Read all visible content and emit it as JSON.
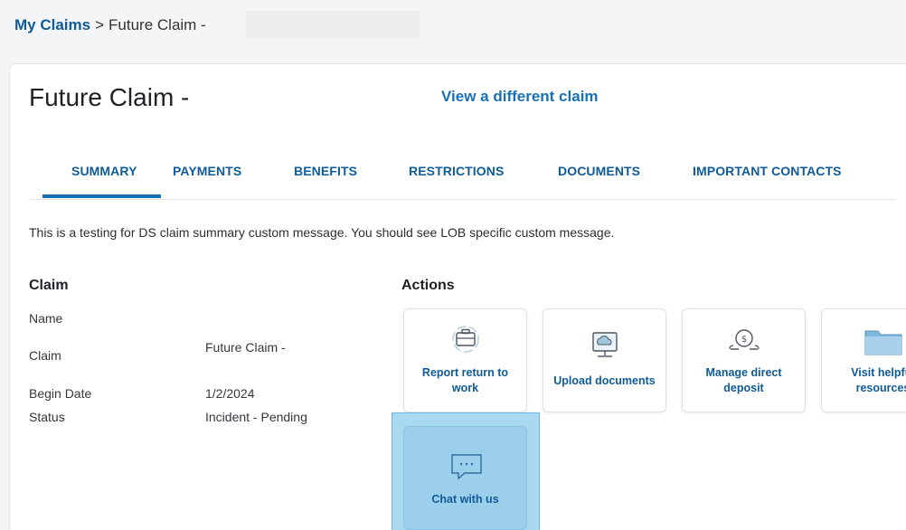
{
  "breadcrumb": {
    "root": "My Claims",
    "separator": ">",
    "current": "Future Claim -"
  },
  "header": {
    "title": "Future Claim -",
    "switch_link": "View a different claim"
  },
  "tabs": [
    {
      "label": "SUMMARY",
      "active": true
    },
    {
      "label": "PAYMENTS",
      "active": false
    },
    {
      "label": "BENEFITS",
      "active": false
    },
    {
      "label": "RESTRICTIONS",
      "active": false
    },
    {
      "label": "DOCUMENTS",
      "active": false
    },
    {
      "label": "IMPORTANT CONTACTS",
      "active": false
    }
  ],
  "message": "This is a testing for DS claim summary custom message. You should see LOB specific custom message.",
  "claim": {
    "heading": "Claim",
    "rows": [
      {
        "label": "Name",
        "value": ""
      },
      {
        "label": "Claim",
        "value": "Future Claim -"
      },
      {
        "label": "Begin Date",
        "value": "1/2/2024"
      },
      {
        "label": "Status",
        "value": "Incident - Pending"
      }
    ]
  },
  "actions": {
    "heading": "Actions",
    "items": [
      {
        "label": "Report return to work",
        "icon": "briefcase-icon"
      },
      {
        "label": "Upload documents",
        "icon": "cloud-upload-icon"
      },
      {
        "label": "Manage direct deposit",
        "icon": "money-deposit-icon"
      },
      {
        "label": "Visit helpful resources",
        "icon": "folder-icon"
      },
      {
        "label": "Chat with us",
        "icon": "chat-bubble-icon"
      }
    ]
  },
  "colors": {
    "link": "#0f5b97",
    "accent": "#1a70b5",
    "highlight": "#a9d8f1"
  }
}
